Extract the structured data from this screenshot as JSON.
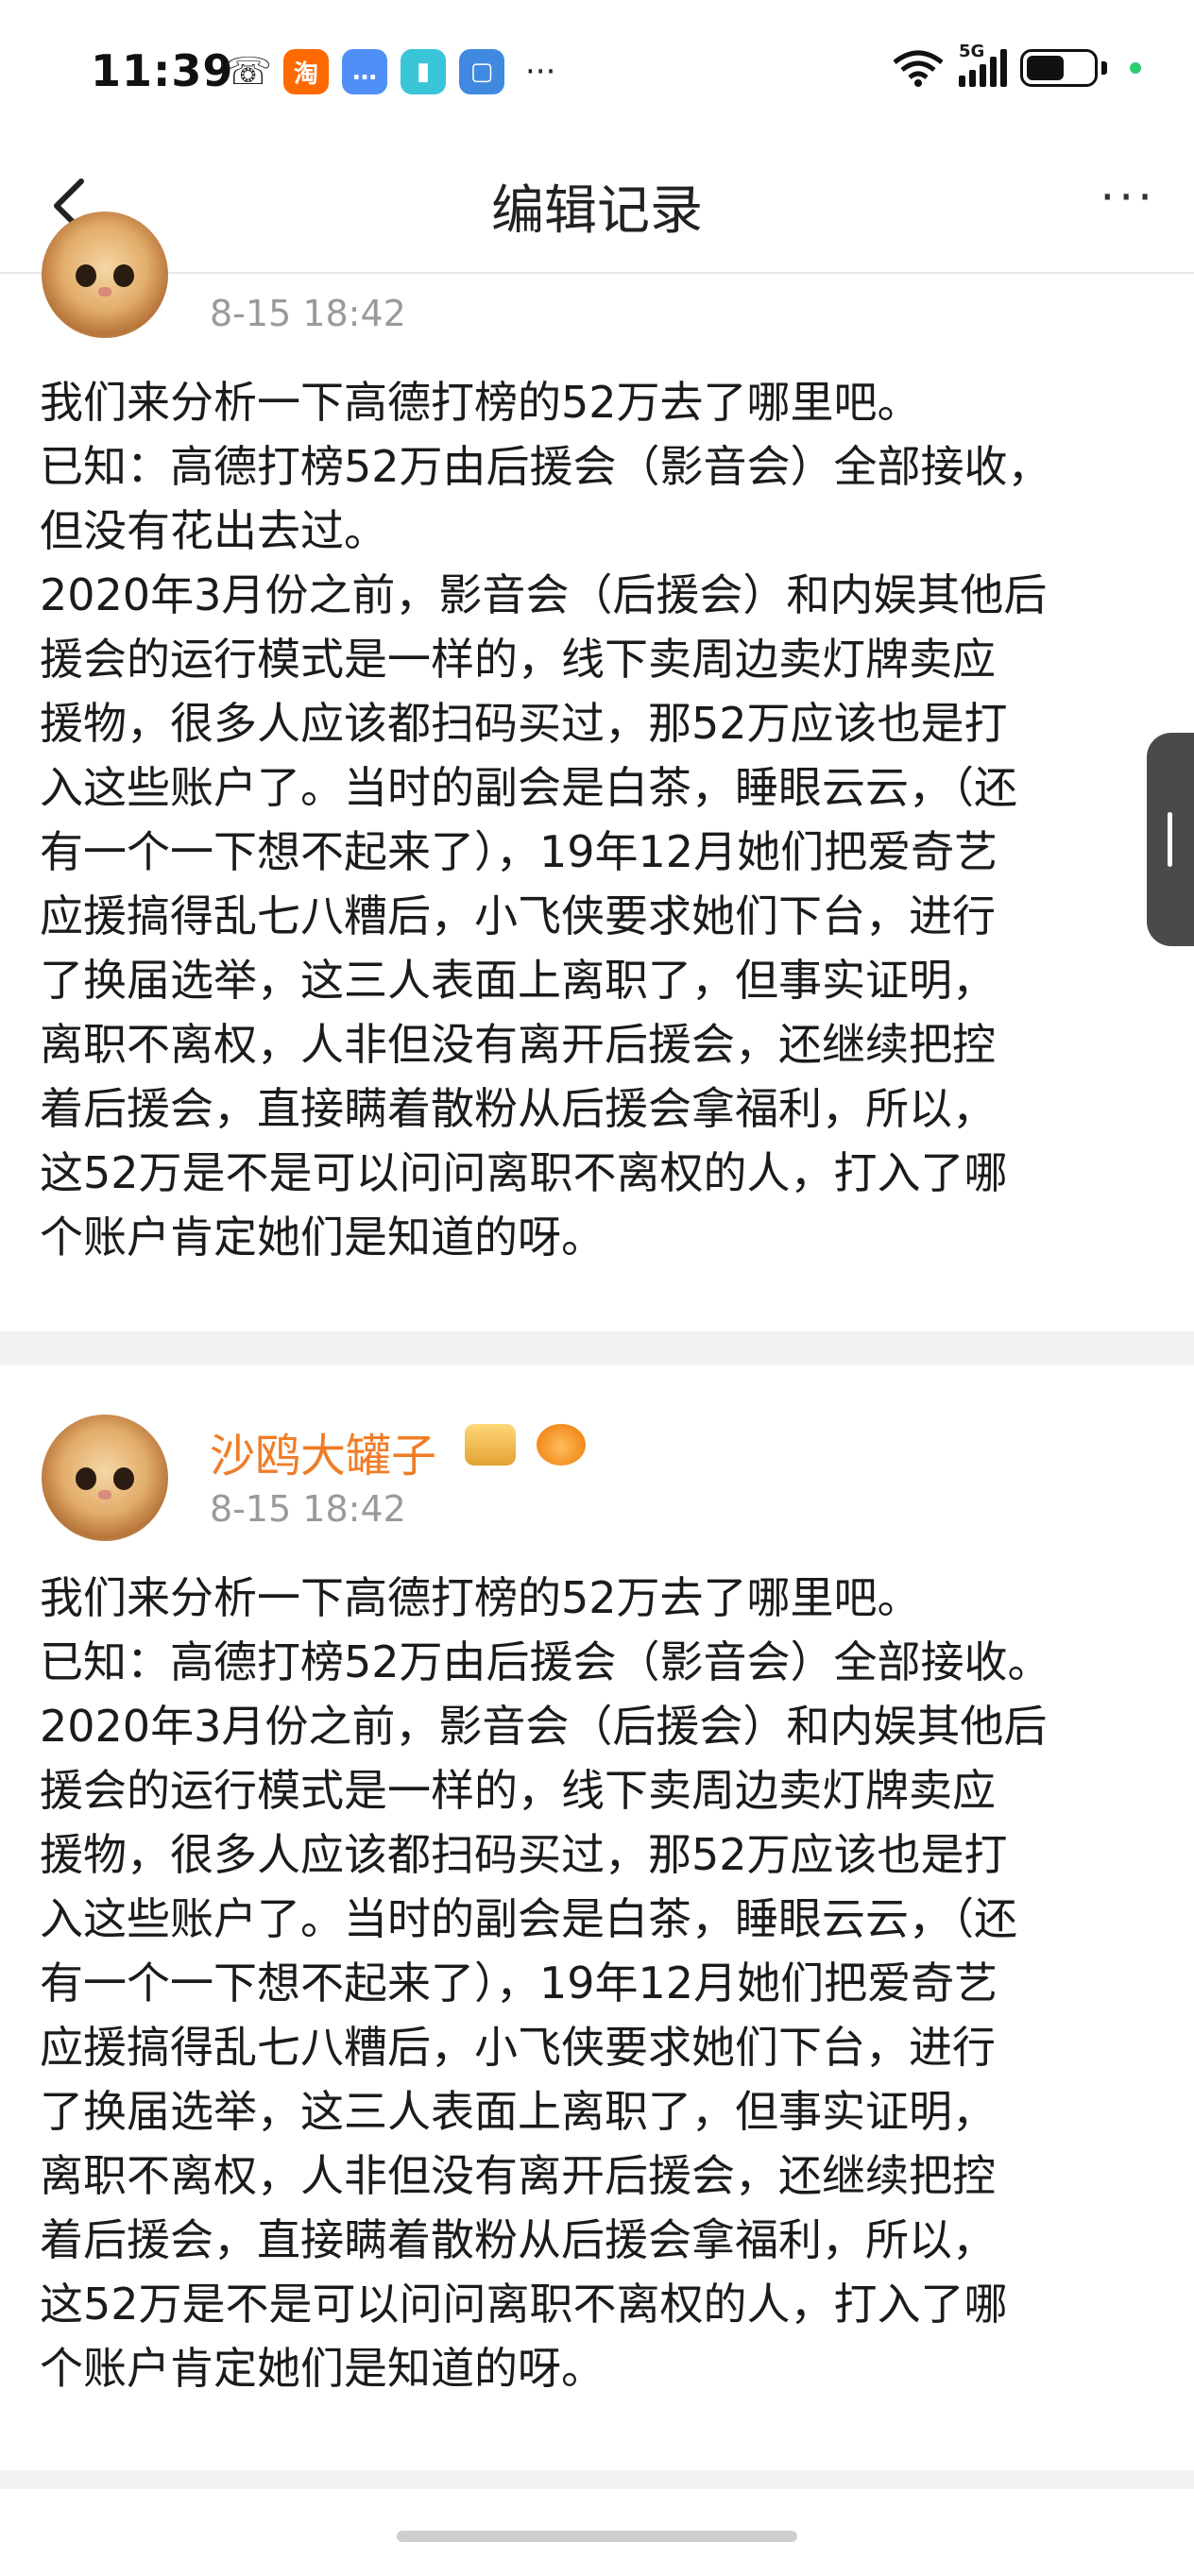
{
  "status_bar": {
    "time": "11:39",
    "apps": [
      {
        "name": "taobao-icon",
        "glyph": "淘",
        "color": "#ff6a00"
      },
      {
        "name": "chat-icon",
        "glyph": "…",
        "color": "#4f8ff7"
      },
      {
        "name": "book-icon",
        "glyph": "▮",
        "color": "#3ac4d8"
      },
      {
        "name": "notes-icon",
        "glyph": "▢",
        "color": "#3f8ae0"
      }
    ],
    "more_glyph": "···",
    "network": "5G",
    "battery_fraction": 0.58
  },
  "nav": {
    "title": "编辑记录",
    "more_glyph": "···"
  },
  "records": [
    {
      "timestamp": "8-15 18:42",
      "lines": [
        "我们来分析一下高德打榜的52万去了哪里吧。",
        "已知：高德打榜52万由后援会（影音会）全部接收，",
        "但没有花出去过。",
        "2020年3月份之前，影音会（后援会）和内娱其他后",
        "援会的运行模式是一样的，线下卖周边卖灯牌卖应",
        "援物，很多人应该都扫码买过，那52万应该也是打",
        "入这些账户了。当时的副会是白茶，睡眼云云，（还",
        "有一个一下想不起来了），19年12月她们把爱奇艺",
        "应援搞得乱七八糟后，小飞侠要求她们下台，进行",
        "了换届选举，这三人表面上离职了，但事实证明，",
        "离职不离权，人非但没有离开后援会，还继续把控",
        "着后援会，直接瞒着散粉从后援会拿福利，所以，",
        "这52万是不是可以问问离职不离权的人，打入了哪",
        "个账户肯定她们是知道的呀。"
      ]
    },
    {
      "username": "沙鸥大罐子",
      "timestamp": "8-15 18:42",
      "lines": [
        "我们来分析一下高德打榜的52万去了哪里吧。",
        "已知：高德打榜52万由后援会（影音会）全部接收。",
        "2020年3月份之前，影音会（后援会）和内娱其他后",
        "援会的运行模式是一样的，线下卖周边卖灯牌卖应",
        "援物，很多人应该都扫码买过，那52万应该也是打",
        "入这些账户了。当时的副会是白茶，睡眼云云，（还",
        "有一个一下想不起来了），19年12月她们把爱奇艺",
        "应援搞得乱七八糟后，小飞侠要求她们下台，进行",
        "了换届选举，这三人表面上离职了，但事实证明，",
        "离职不离权，人非但没有离开后援会，还继续把控",
        "着后援会，直接瞒着散粉从后援会拿福利，所以，",
        "这52万是不是可以问问离职不离权的人，打入了哪",
        "个账户肯定她们是知道的呀。"
      ]
    }
  ]
}
